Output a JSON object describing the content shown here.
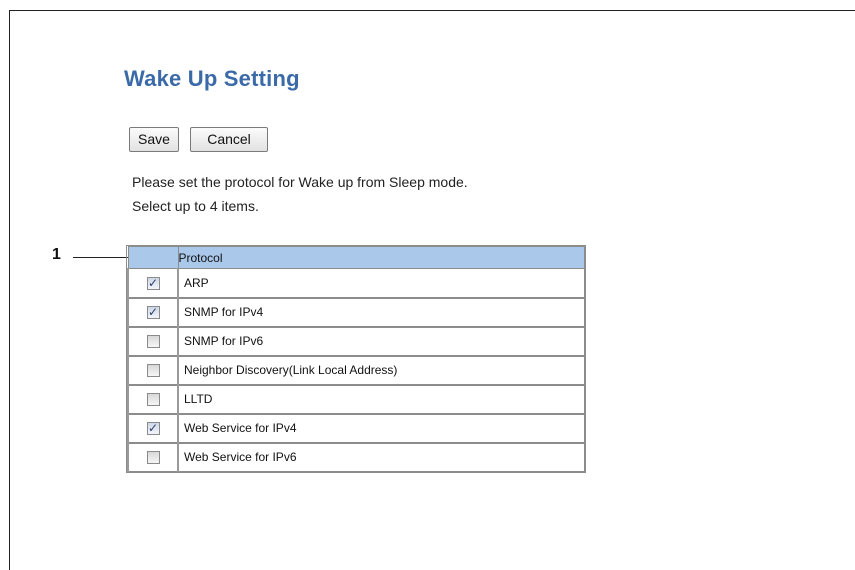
{
  "page_title": "Wake Up Setting",
  "buttons": {
    "save_label": "Save",
    "cancel_label": "Cancel"
  },
  "instructions": {
    "line1": "Please set the protocol for Wake up from Sleep mode.",
    "line2": "Select up to 4 items."
  },
  "callout": {
    "number": "1"
  },
  "table": {
    "header": "Protocol",
    "rows": [
      {
        "label": "ARP",
        "checked": true
      },
      {
        "label": "SNMP for IPv4",
        "checked": true
      },
      {
        "label": "SNMP for IPv6",
        "checked": false
      },
      {
        "label": "Neighbor Discovery(Link Local Address)",
        "checked": false
      },
      {
        "label": "LLTD",
        "checked": false
      },
      {
        "label": "Web Service for IPv4",
        "checked": true
      },
      {
        "label": "Web Service for IPv6",
        "checked": false
      }
    ]
  },
  "colors": {
    "title": "#3b6aa8",
    "header_bg": "#a9c8ea"
  }
}
